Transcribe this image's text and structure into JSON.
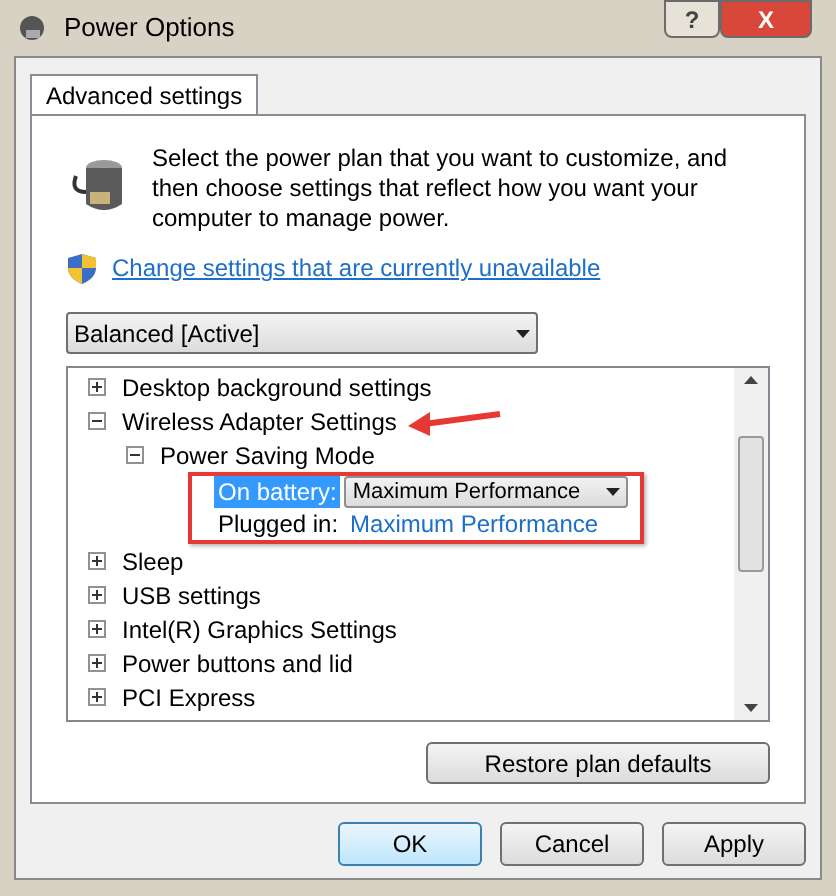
{
  "window": {
    "title": "Power Options",
    "buttons": [
      {
        "kind": "help",
        "label": "?"
      },
      {
        "kind": "close",
        "label": "X"
      }
    ]
  },
  "tabs": [
    {
      "label": "Advanced settings",
      "selected": true
    }
  ],
  "intro": "Select the power plan that you want to customize, and then choose settings that reflect how you want your computer to manage power.",
  "link": "Change settings that are currently unavailable",
  "plan_select": {
    "value": "Balanced [Active]"
  },
  "tree": [
    {
      "label": "Desktop background settings",
      "expanded": false
    },
    {
      "label": "Wireless Adapter Settings",
      "expanded": true,
      "annotated": true,
      "children": [
        {
          "label": "Power Saving Mode",
          "expanded": true,
          "settings": [
            {
              "kind": "dropdown",
              "label": "On battery:",
              "value": "Maximum Performance",
              "selected": true
            },
            {
              "kind": "link",
              "label": "Plugged in:",
              "value": "Maximum Performance",
              "selected": false
            }
          ]
        }
      ]
    },
    {
      "label": "Sleep",
      "expanded": false
    },
    {
      "label": "USB settings",
      "expanded": false
    },
    {
      "label": "Intel(R) Graphics Settings",
      "expanded": false
    },
    {
      "label": "Power buttons and lid",
      "expanded": false
    },
    {
      "label": "PCI Express",
      "expanded": false
    }
  ],
  "restore_button": "Restore plan defaults",
  "buttons": [
    {
      "label": "OK",
      "selected": true
    },
    {
      "label": "Cancel",
      "selected": false
    },
    {
      "label": "Apply",
      "selected": false
    }
  ]
}
